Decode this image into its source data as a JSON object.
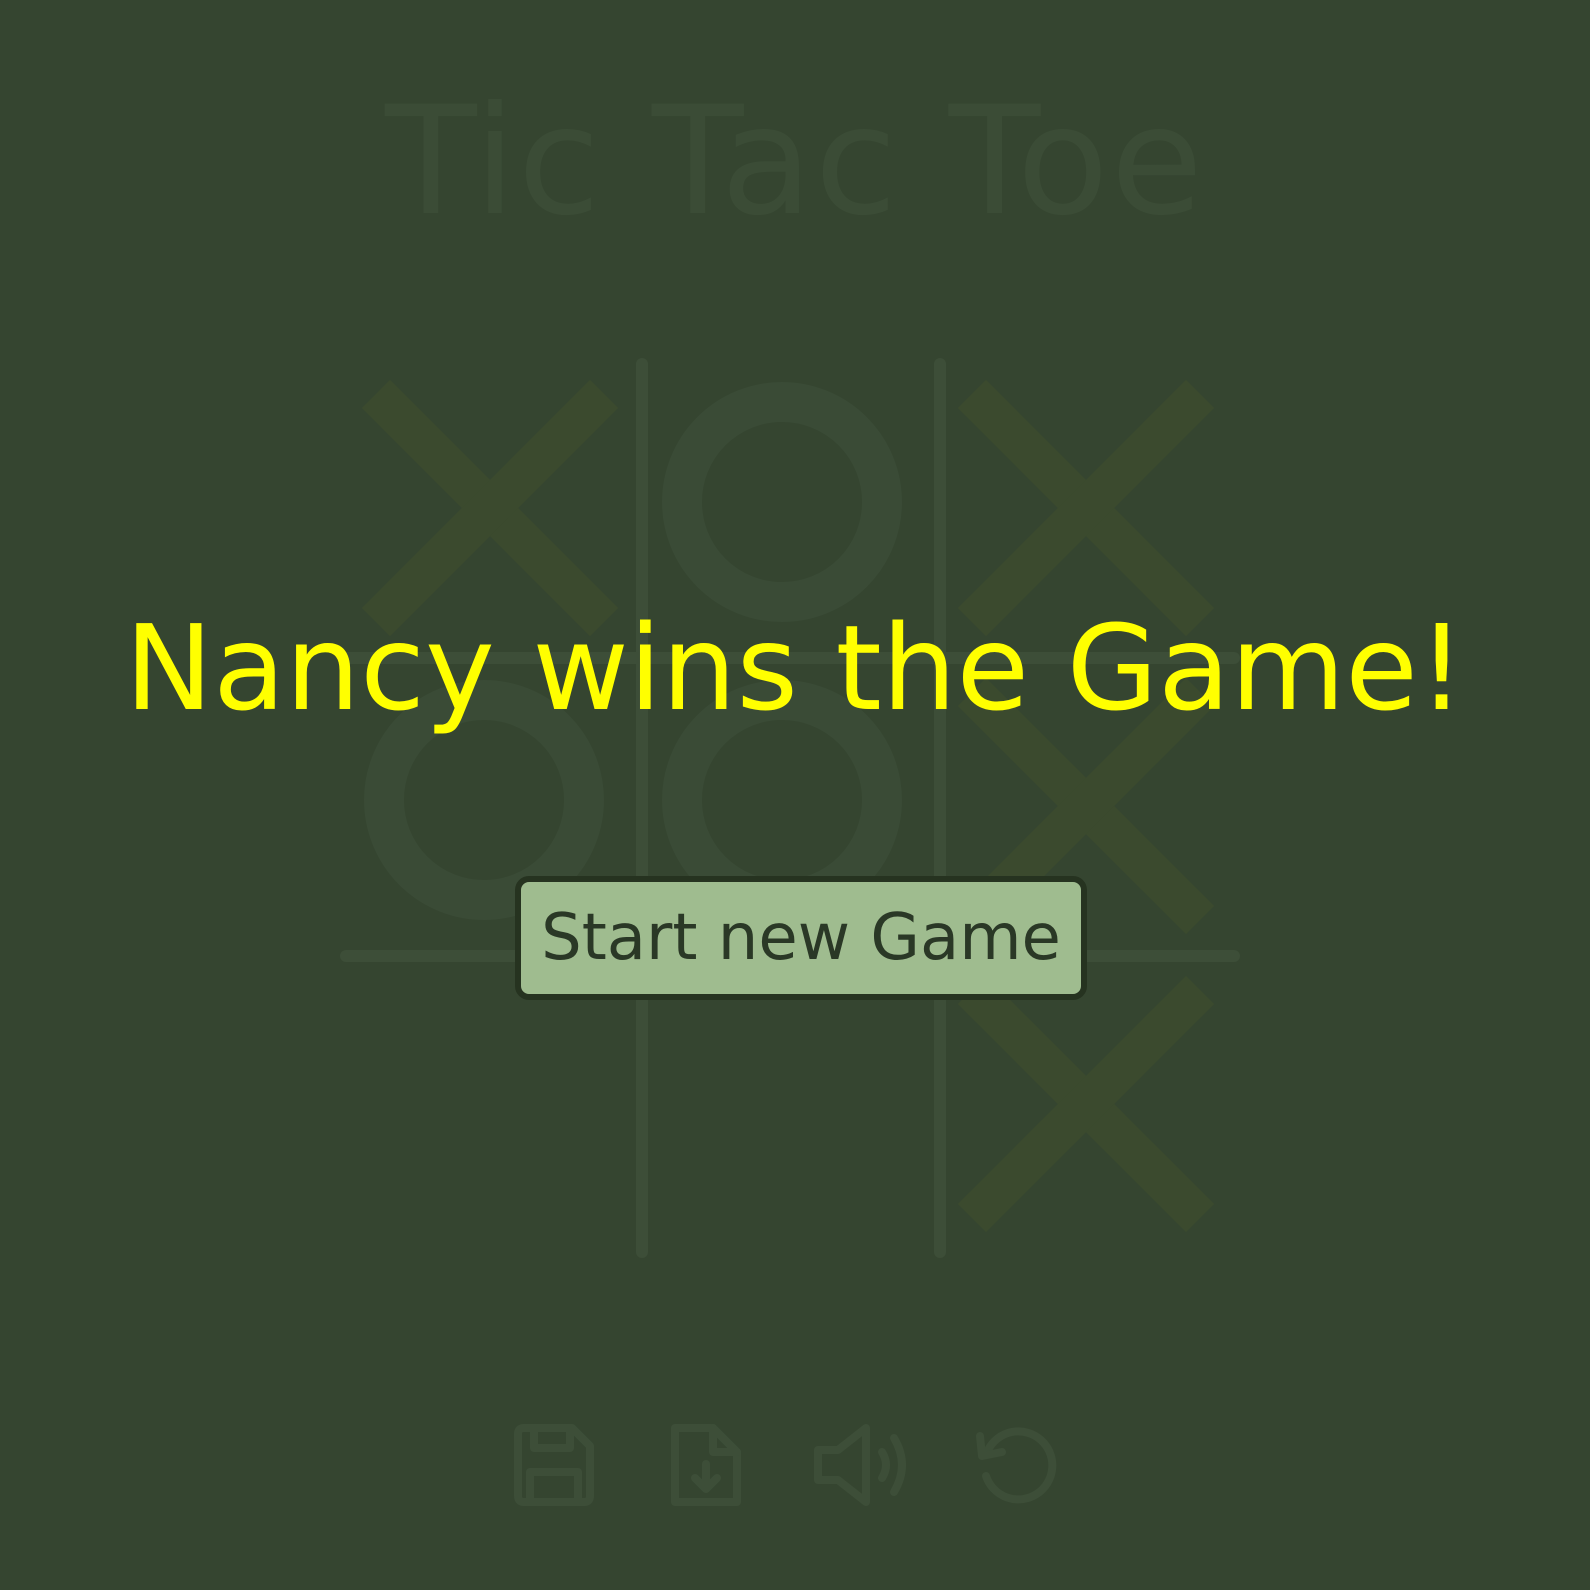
{
  "game": {
    "title": "Tic Tac Toe",
    "board": [
      [
        "X",
        "O",
        "X"
      ],
      [
        "O",
        "O",
        "X"
      ],
      [
        "",
        "",
        "X"
      ]
    ]
  },
  "overlay": {
    "message": "Nancy wins the Game!",
    "new_game_label": "Start new Game"
  },
  "toolbar": {
    "items": [
      {
        "icon": "save-icon"
      },
      {
        "icon": "load-file-icon"
      },
      {
        "icon": "sound-icon"
      },
      {
        "icon": "undo-icon"
      }
    ]
  },
  "colors": {
    "background": "#354530",
    "x_mark": "#3b4a2e",
    "o_mark": "#3a4b36",
    "message": "#ffff00",
    "button": "#9fbc8f"
  }
}
